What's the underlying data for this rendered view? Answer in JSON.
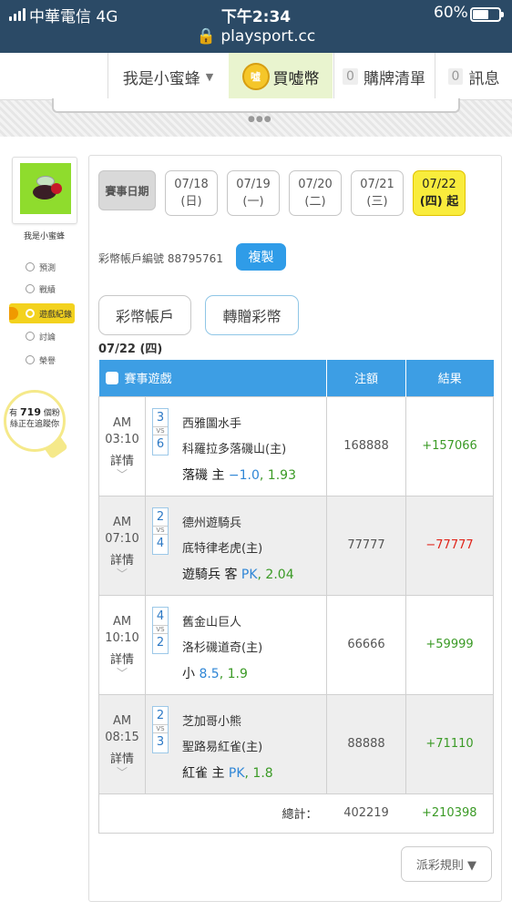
{
  "status_bar": {
    "carrier": "中華電信 4G",
    "time": "下午2:34",
    "url": "playsport.cc",
    "battery": "60%"
  },
  "topnav": {
    "user": "我是小蜜蜂",
    "buy": "買噓幣",
    "cart_count": "0",
    "cart": "購牌清單",
    "msg_count": "0",
    "msg": "訊息"
  },
  "sidebar": {
    "name": "我是小蜜蜂",
    "items": [
      {
        "label": "預測",
        "icon": "target-icon"
      },
      {
        "label": "戰績",
        "icon": "chat-icon"
      },
      {
        "label": "遊戲紀錄",
        "icon": "circle-icon"
      },
      {
        "label": "討論",
        "icon": "pencil-icon"
      },
      {
        "label": "榮譽",
        "icon": "trophy-icon"
      }
    ],
    "fans_prefix": "有",
    "fans_count": "719",
    "fans_unit": "個粉",
    "fans_suffix": "絲正在追蹤你"
  },
  "main": {
    "date_label": "賽事日期",
    "dates": [
      {
        "date": "07/18",
        "day": "(日)"
      },
      {
        "date": "07/19",
        "day": "(一)"
      },
      {
        "date": "07/20",
        "day": "(二)"
      },
      {
        "date": "07/21",
        "day": "(三)"
      },
      {
        "date": "07/22",
        "day": "(四) 起"
      }
    ],
    "account_label": "彩幣帳戶編號 88795761",
    "copy_btn": "複製",
    "tab_account": "彩幣帳戶",
    "tab_transfer": "轉贈彩幣",
    "date_title": "07/22 (四)",
    "table": {
      "headers": [
        "賽事遊戲",
        "注額",
        "結果"
      ],
      "rows": [
        {
          "ampm": "AM",
          "time": "03:10",
          "detail": "詳情",
          "s1": "3",
          "vs": "VS",
          "s2": "6",
          "team1": "西雅圖水手",
          "team2": "科羅拉多落磯山(主)",
          "pick_team": "落磯 主",
          "pick_line": "−1.0",
          "pick_odds": ", 1.93",
          "amount": "168888",
          "result": "+157066",
          "win": true
        },
        {
          "ampm": "AM",
          "time": "07:10",
          "detail": "詳情",
          "s1": "2",
          "vs": "VS",
          "s2": "4",
          "team1": "德州遊騎兵",
          "team2": "底特律老虎(主)",
          "pick_team": "遊騎兵 客",
          "pick_line": "PK",
          "pick_odds": ", 2.04",
          "amount": "77777",
          "result": "−77777",
          "win": false
        },
        {
          "ampm": "AM",
          "time": "10:10",
          "detail": "詳情",
          "s1": "4",
          "vs": "VS",
          "s2": "2",
          "team1": "舊金山巨人",
          "team2": "洛杉磯道奇(主)",
          "pick_team": "小",
          "pick_line": "8.5",
          "pick_odds": ", 1.9",
          "amount": "66666",
          "result": "+59999",
          "win": true
        },
        {
          "ampm": "AM",
          "time": "08:15",
          "detail": "詳情",
          "s1": "2",
          "vs": "VS",
          "s2": "3",
          "team1": "芝加哥小熊",
          "team2": "聖路易紅雀(主)",
          "pick_team": "紅雀 主",
          "pick_line": "PK",
          "pick_odds": ", 1.8",
          "amount": "88888",
          "result": "+71110",
          "win": true
        }
      ],
      "total_label": "總計：",
      "total_amount": "402219",
      "total_result": "+210398"
    },
    "rules_btn": "派彩規則 ▼"
  },
  "colors": {
    "header_blue": "#3d9ee4",
    "win_green": "#3a9a25",
    "lose_red": "#e0251b",
    "selected_yellow": "#f9ec3c",
    "sidebar_active": "#f3d21e"
  }
}
